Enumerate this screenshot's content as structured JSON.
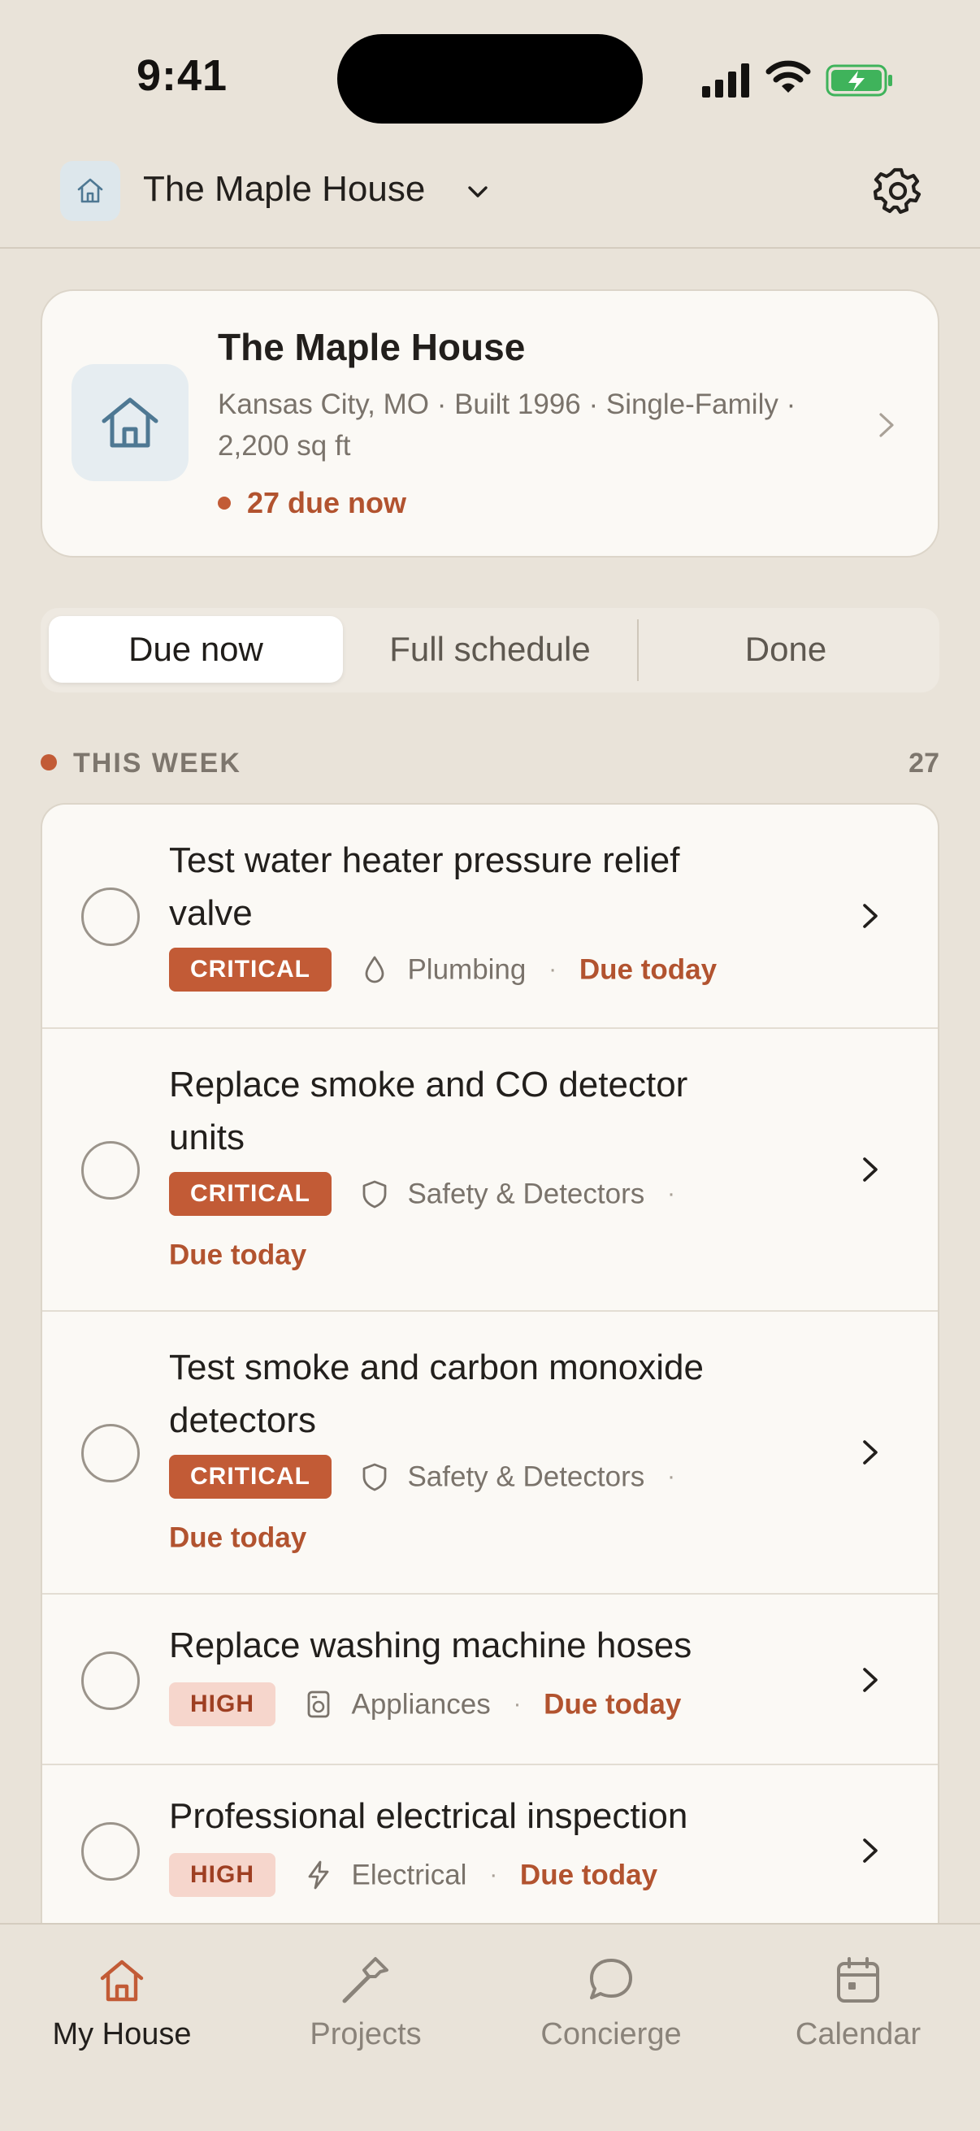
{
  "status_bar": {
    "time": "9:41"
  },
  "header": {
    "title": "The Maple House",
    "caret_icon": "chevron-down-icon",
    "settings_icon": "gear-icon"
  },
  "house_card": {
    "name": "The Maple House",
    "meta": "Kansas City, MO · Built 1996 · Single-Family · 2,200 sq ft",
    "due": "27 due now"
  },
  "tabs": [
    {
      "label": "Due now",
      "active": true
    },
    {
      "label": "Full schedule",
      "active": false
    },
    {
      "label": "Done",
      "active": false
    }
  ],
  "section": {
    "title": "THIS WEEK",
    "count": "27"
  },
  "tasks": [
    {
      "title": "Test water heater pressure relief valve",
      "priority": "CRITICAL",
      "category": "Plumbing",
      "category_icon": "water-drop-icon",
      "due": "Due today",
      "separator": "·"
    },
    {
      "title": "Replace smoke and CO detector units",
      "priority": "CRITICAL",
      "category": "Safety & Detectors",
      "category_icon": "shield-icon",
      "due": "Due today",
      "separator": "·"
    },
    {
      "title": "Test smoke and carbon monoxide detectors",
      "priority": "CRITICAL",
      "category": "Safety & Detectors",
      "category_icon": "shield-icon",
      "due": "Due today",
      "separator": "·"
    },
    {
      "title": "Replace washing machine hoses",
      "priority": "HIGH",
      "category": "Appliances",
      "category_icon": "washing-machine-icon",
      "due": "Due today",
      "separator": "·"
    },
    {
      "title": "Professional electrical inspection",
      "priority": "HIGH",
      "category": "Electrical",
      "category_icon": "lightning-icon",
      "due": "Due today",
      "separator": "·"
    }
  ],
  "tabbar": [
    {
      "label": "My House",
      "icon": "house-icon",
      "active": true
    },
    {
      "label": "Projects",
      "icon": "hammer-icon",
      "active": false
    },
    {
      "label": "Concierge",
      "icon": "chat-bubble-icon",
      "active": false
    },
    {
      "label": "Calendar",
      "icon": "calendar-icon",
      "active": false
    }
  ],
  "colors": {
    "accent": "#C25B36",
    "background": "#E9E3D9",
    "card": "#FBF9F5",
    "house_icon": "#4E7893"
  }
}
